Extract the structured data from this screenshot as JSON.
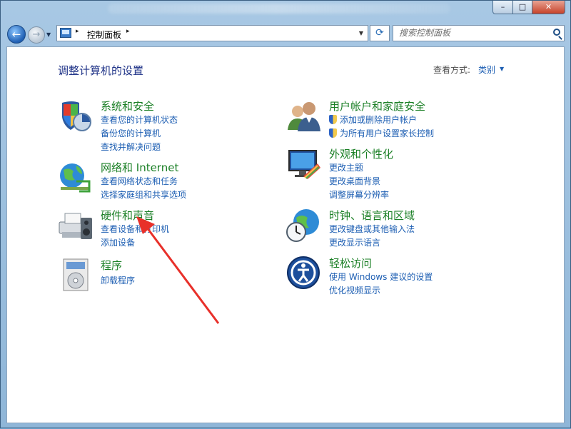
{
  "window": {
    "controls": {
      "minimize": "–",
      "maximize": "□",
      "close": "✕"
    }
  },
  "nav": {
    "back_glyph": "←",
    "forward_glyph": "→",
    "address": {
      "crumb": "控制面板",
      "sep": "▸"
    },
    "refresh_glyph": "⟳",
    "search": {
      "placeholder": "搜索控制面板"
    }
  },
  "page": {
    "heading": "调整计算机的设置",
    "view_by_label": "查看方式:",
    "view_by_value": "类别",
    "view_by_arrow": "▼"
  },
  "categories_left": [
    {
      "title": "系统和安全",
      "icon": "system-security-icon",
      "links": [
        "查看您的计算机状态",
        "备份您的计算机",
        "查找并解决问题"
      ]
    },
    {
      "title": "网络和 Internet",
      "icon": "network-internet-icon",
      "links": [
        "查看网络状态和任务",
        "选择家庭组和共享选项"
      ]
    },
    {
      "title": "硬件和声音",
      "icon": "hardware-sound-icon",
      "links": [
        "查看设备和打印机",
        "添加设备"
      ]
    },
    {
      "title": "程序",
      "icon": "programs-icon",
      "links": [
        "卸载程序"
      ]
    }
  ],
  "categories_right": [
    {
      "title": "用户帐户和家庭安全",
      "icon": "user-accounts-icon",
      "links": [
        "添加或删除用户帐户",
        "为所有用户设置家长控制"
      ],
      "shielded": true
    },
    {
      "title": "外观和个性化",
      "icon": "appearance-icon",
      "links": [
        "更改主题",
        "更改桌面背景",
        "调整屏幕分辨率"
      ]
    },
    {
      "title": "时钟、语言和区域",
      "icon": "clock-language-icon",
      "links": [
        "更改键盘或其他输入法",
        "更改显示语言"
      ]
    },
    {
      "title": "轻松访问",
      "icon": "ease-of-access-icon",
      "links": [
        "使用 Windows 建议的设置",
        "优化视频显示"
      ]
    }
  ],
  "annotation": {
    "color": "#e8302a"
  }
}
